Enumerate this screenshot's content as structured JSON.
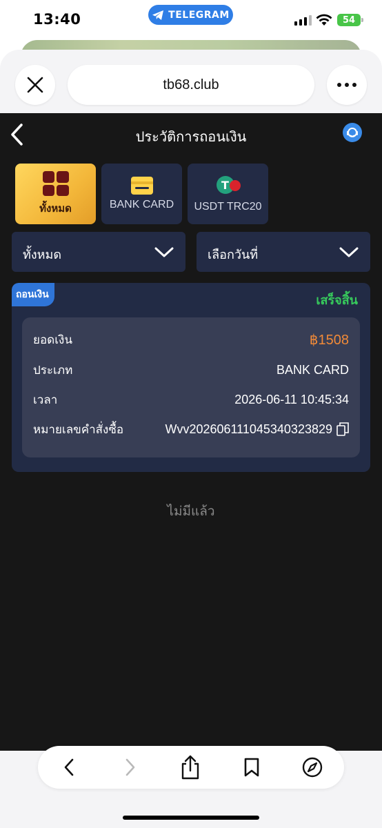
{
  "status_bar": {
    "time": "13:40",
    "telegram_label": "TELEGRAM",
    "battery": "54"
  },
  "browser": {
    "url": "tb68.club",
    "icons": [
      "close-icon",
      "more-icon",
      "back-icon",
      "forward-icon",
      "share-icon",
      "bookmark-icon",
      "compass-icon"
    ]
  },
  "app": {
    "title": "ประวัติการถอนเงิน",
    "tabs": [
      {
        "label": "ทั้งหมด",
        "icon": "grid-icon",
        "active": true
      },
      {
        "label": "BANK CARD",
        "icon": "card-icon",
        "active": false
      },
      {
        "label": "USDT TRC20",
        "icon": "usdt-icon",
        "active": false
      }
    ],
    "filters": {
      "type": "ทั้งหมด",
      "date": "เลือกวันที่"
    },
    "record": {
      "badge": "ถอนเงิน",
      "status": "เสร็จสิ้น",
      "amount_label": "ยอดเงิน",
      "amount": "฿1508",
      "type_label": "ประเภท",
      "type": "BANK CARD",
      "time_label": "เวลา",
      "time": "2026-06-11 10:45:34",
      "order_label": "หมายเลขคำสั่งซื้อ",
      "order": "Wvv2026061110453403238​29"
    },
    "no_more": "ไม่มีแล้ว"
  },
  "colors": {
    "background": "#171717",
    "panel": "#232b45",
    "active_tab": "#f3b73a",
    "status_green": "#37c95c",
    "amount_orange": "#f18a38",
    "badge_blue": "#2f75d8"
  }
}
